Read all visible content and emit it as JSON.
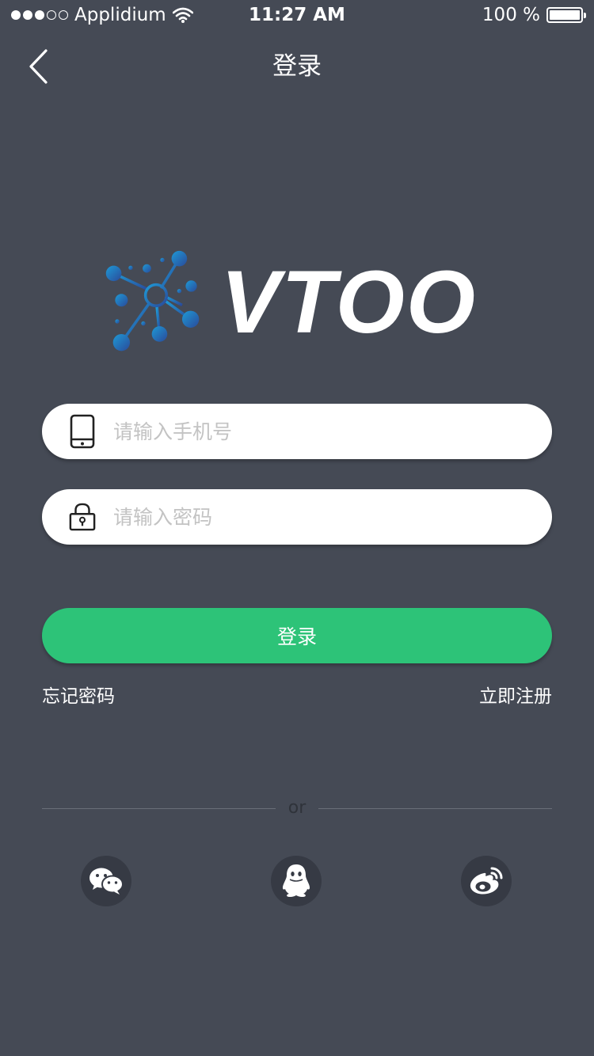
{
  "status_bar": {
    "carrier": "Applidium",
    "time": "11:27 AM",
    "battery": "100 %",
    "signal_icon": "signal-dots-icon",
    "wifi_icon": "wifi-icon",
    "battery_icon": "battery-icon"
  },
  "nav": {
    "title": "登录",
    "back_icon": "chevron-left-icon"
  },
  "logo": {
    "text": "VTOO",
    "icon": "network-nodes-icon"
  },
  "form": {
    "phone_placeholder": "请输入手机号",
    "phone_icon": "phone-icon",
    "password_placeholder": "请输入密码",
    "password_icon": "lock-icon",
    "login_label": "登录"
  },
  "links": {
    "forgot_password": "忘记密码",
    "register": "立即注册"
  },
  "divider": {
    "text": "or"
  },
  "social": [
    {
      "icon": "wechat-icon"
    },
    {
      "icon": "qq-icon"
    },
    {
      "icon": "weibo-icon"
    }
  ],
  "colors": {
    "background": "#454a55",
    "accent_green": "#2dc378",
    "social_circle": "#363a44",
    "logo_blue": "#1e8fd0"
  }
}
